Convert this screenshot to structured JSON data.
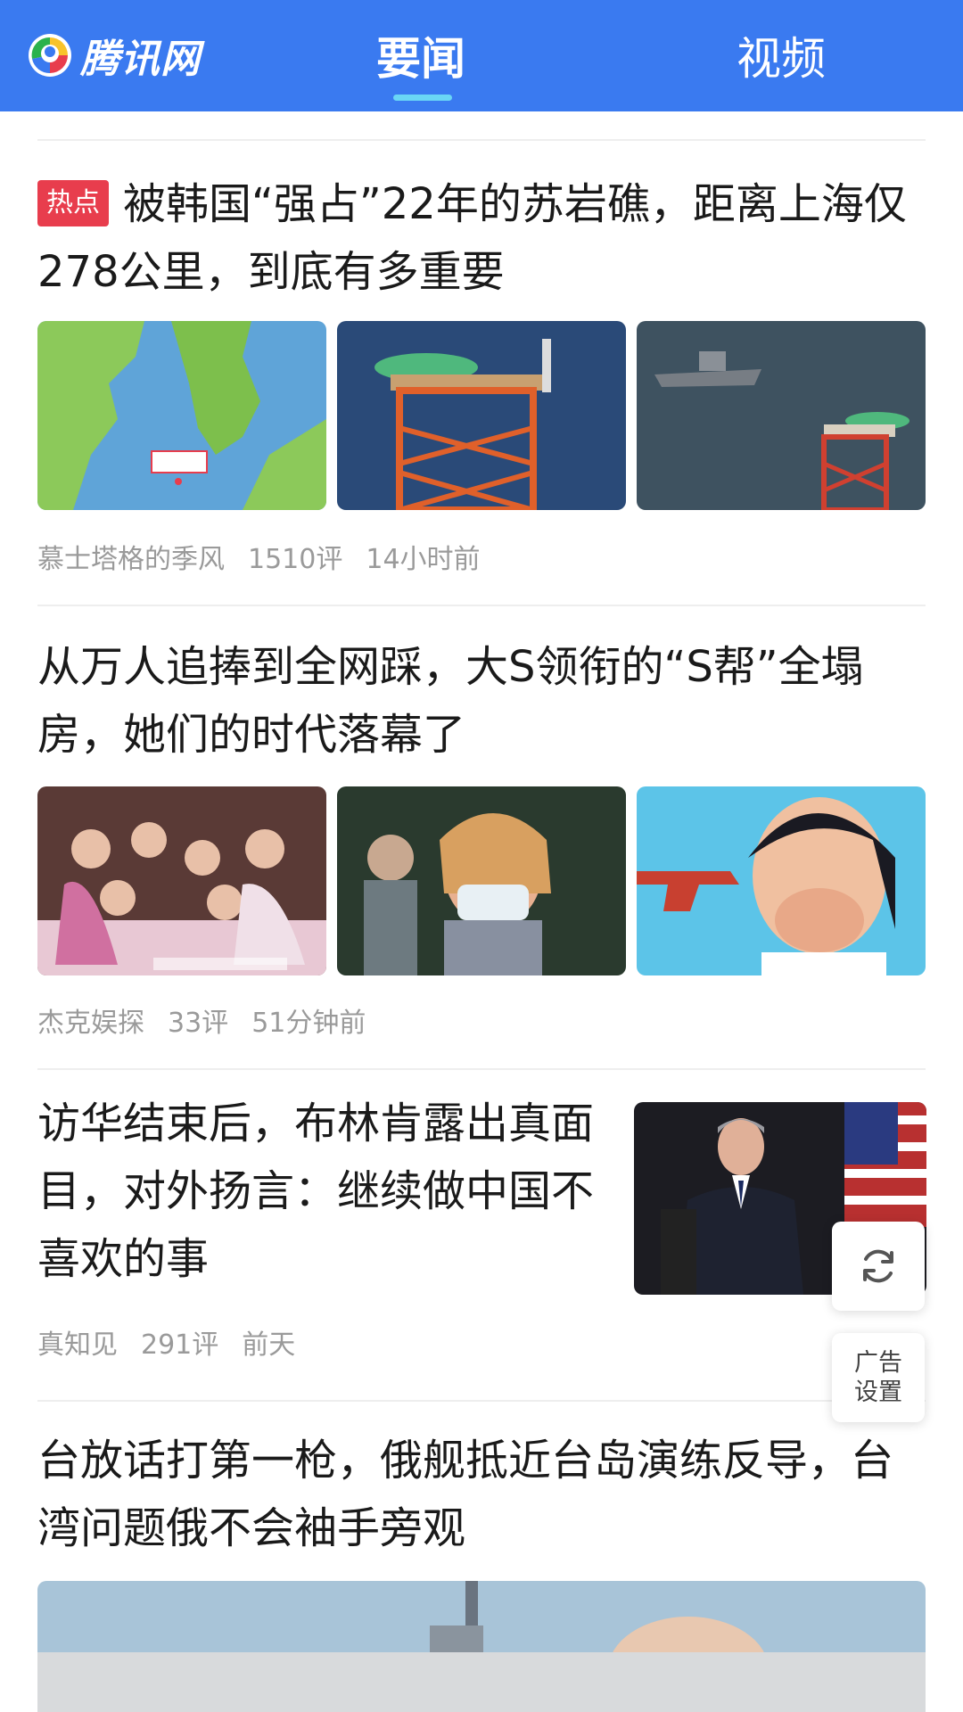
{
  "header": {
    "logo_text": "腾讯网",
    "tabs": [
      {
        "label": "要闻",
        "active": true
      },
      {
        "label": "视频",
        "active": false
      }
    ],
    "brand_color": "#3a7af0",
    "underline_color": "#6ad6f5"
  },
  "articles": [
    {
      "badge": "热点",
      "title": "被韩国“强占”22年的苏岩礁，距离上海仅278公里，到底有多重要",
      "source": "慕士塔格的季风",
      "comments": "1510评",
      "time": "14小时前",
      "image_names": [
        "map-image",
        "oil-platform-image",
        "warship-platform-image"
      ]
    },
    {
      "title": "从万人追捧到全网踩，大S领衔的“S帮”全塌房，她们的时代落幕了",
      "source": "杰克娱探",
      "comments": "33评",
      "time": "51分钟前",
      "image_names": [
        "group-photo-image",
        "crying-woman-image",
        "gun-photo-image"
      ]
    },
    {
      "title": "访华结束后，布林肯露出真面目，对外扬言：继续做中国不喜欢的事",
      "source": "真知见",
      "comments": "291评",
      "time": "前天",
      "image_names": [
        "speaker-flag-image"
      ]
    },
    {
      "title": "台放话打第一枪，俄舰抵近台岛演练反导，台湾问题俄不会袖手旁观",
      "image_names": [
        "ship-image"
      ]
    }
  ],
  "floating": {
    "refresh_icon": "refresh-icon",
    "ad_settings_line1": "广告",
    "ad_settings_line2": "设置"
  },
  "colors": {
    "hot_badge": "#e83d4d",
    "meta_text": "#9a9a9a"
  }
}
